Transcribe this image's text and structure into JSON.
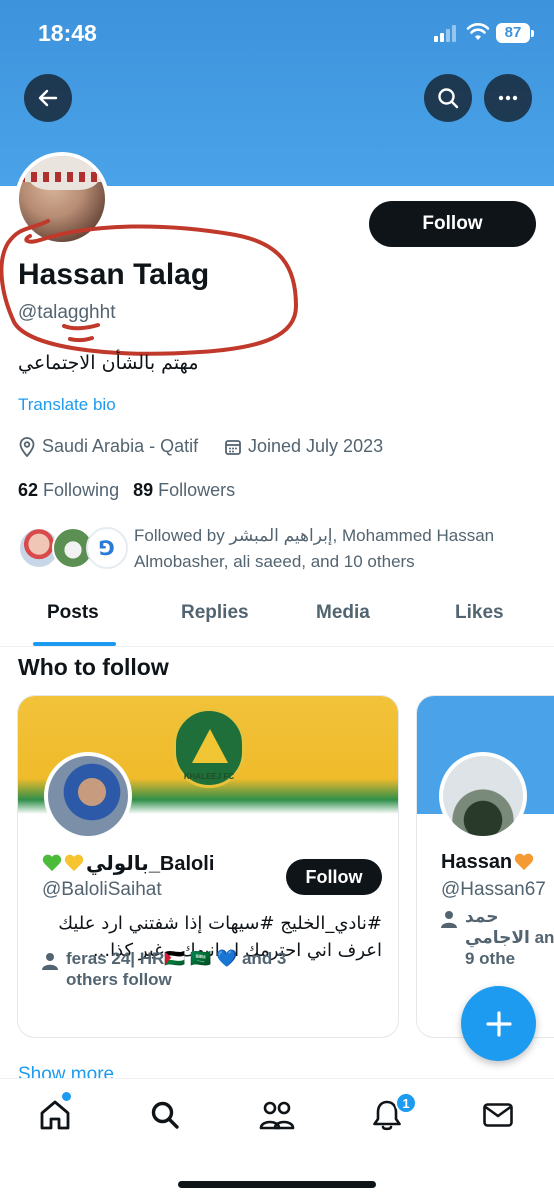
{
  "status_bar": {
    "time": "18:48",
    "battery": "87"
  },
  "profile": {
    "display_name": "Hassan Talag",
    "handle": "@talagghht",
    "bio": "مهتم بالشأن الاجتماعي",
    "translate_label": "Translate bio",
    "location": "Saudi Arabia - Qatif",
    "joined": "Joined July 2023",
    "following_count": "62",
    "following_label": "Following",
    "followers_count": "89",
    "followers_label": "Followers",
    "followed_by": "Followed by إبراهيم المبشر, Mohammed Hassan Almobasher, ali saeed, and 10 others",
    "follow_label": "Follow"
  },
  "tabs": [
    {
      "label": "Posts",
      "active": true
    },
    {
      "label": "Replies",
      "active": false
    },
    {
      "label": "Media",
      "active": false
    },
    {
      "label": "Likes",
      "active": false
    }
  ],
  "who_to_follow": {
    "heading": "Who to follow",
    "cards": [
      {
        "name": "بالولي_Baloli",
        "handle": "@BaloliSaihat",
        "follow_label": "Follow",
        "bio": "#نادي_الخليج #سيهات إذا شفتني ارد عليك اعرف اني احترمك او انبهك ، غير كذا...",
        "social_context": "feras 24| HR🇵🇸 🇸🇦 💙 and 3 others follow",
        "banner_label": "KHALEEJ FC"
      },
      {
        "name": "Hassan",
        "handle": "@Hassan67",
        "social_context": "حمد الاجامي and 9 othe"
      }
    ],
    "show_more": "Show more"
  },
  "nav": {
    "notifications_badge": "1"
  },
  "colors": {
    "accent": "#1d9bf0",
    "banner": "#4aa3e8",
    "annotation": "#c0392b"
  }
}
